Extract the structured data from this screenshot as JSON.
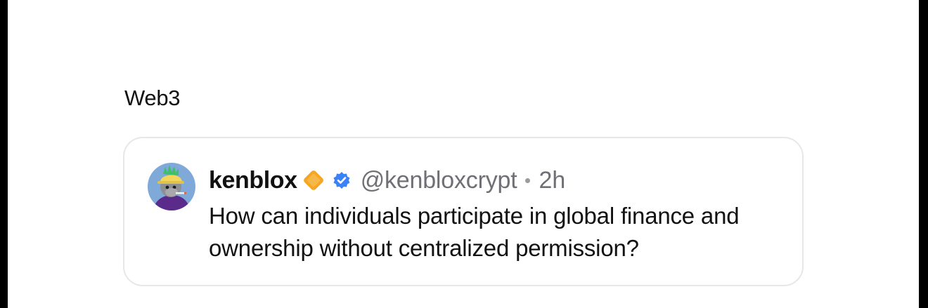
{
  "section": {
    "title": "Web3"
  },
  "post": {
    "username": "kenblox",
    "handle": "@kenbloxcrypt",
    "separator": "•",
    "time": "2h",
    "text": "How can individuals participate in global finance and ownership without centralized permission?",
    "badges": {
      "diamond_icon": "orange-diamond-icon",
      "verified_icon": "blue-verified-check-icon"
    },
    "avatar_icon": "ape-avatar"
  },
  "colors": {
    "diamond": "#f5a623",
    "verified": "#3b82f6",
    "handle_gray": "#6f6f76",
    "card_border": "#e7e7e9"
  }
}
